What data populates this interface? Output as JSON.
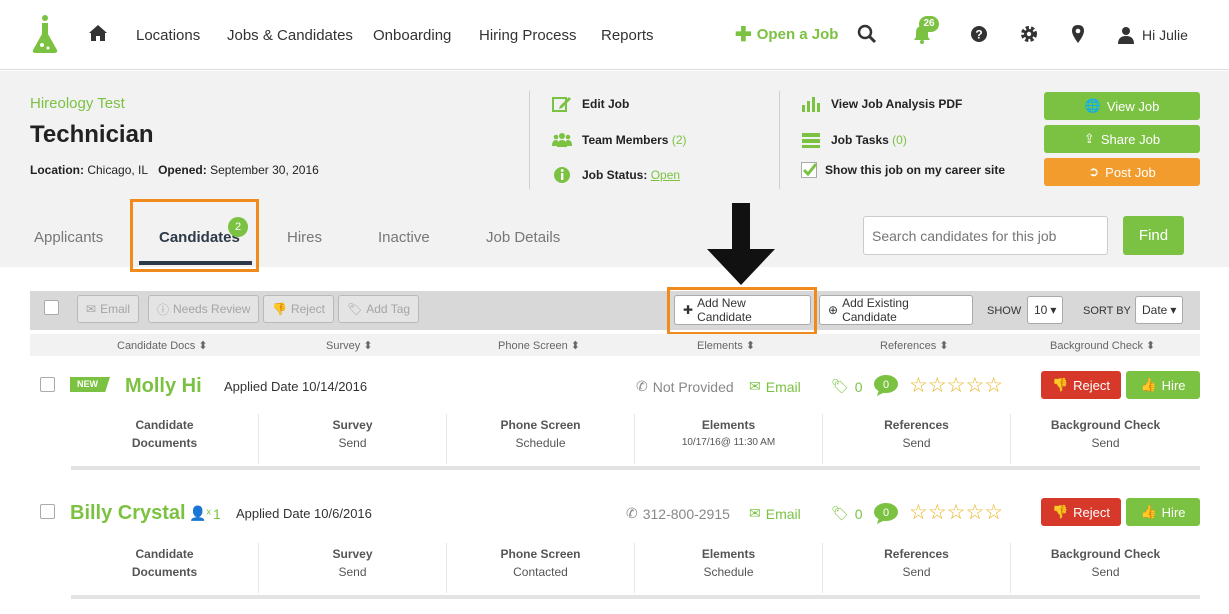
{
  "nav": {
    "links": [
      "Locations",
      "Jobs & Candidates",
      "Onboarding",
      "Hiring Process",
      "Reports"
    ],
    "open_job": "Open a Job",
    "notifications_count": "26",
    "user_greeting": "Hi Julie"
  },
  "job": {
    "company": "Hireology Test",
    "title": "Technician",
    "location_label": "Location:",
    "location": "Chicago, IL",
    "opened_label": "Opened:",
    "opened": "September 30, 2016",
    "edit_job": "Edit Job",
    "team_members": "Team Members",
    "team_members_count": "(2)",
    "job_status_label": "Job Status:",
    "job_status": "Open",
    "view_analysis": "View Job Analysis PDF",
    "job_tasks": "Job Tasks",
    "job_tasks_count": "(0)",
    "show_career_site": "Show this job on my career site",
    "view_job": "View Job",
    "share_job": "Share Job",
    "post_job": "Post Job"
  },
  "tabs": {
    "items": [
      "Applicants",
      "Candidates",
      "Hires",
      "Inactive",
      "Job Details"
    ],
    "candidates_badge": "2",
    "search_placeholder": "Search candidates for this job",
    "find": "Find"
  },
  "toolbar": {
    "email": "Email",
    "needs_review": "Needs Review",
    "reject": "Reject",
    "add_tag": "Add Tag",
    "add_new": "Add New Candidate",
    "add_existing": "Add Existing Candidate",
    "show_label": "SHOW",
    "show_value": "10",
    "sort_label": "SORT BY",
    "sort_value": "Date"
  },
  "columns": [
    "Candidate Docs",
    "Survey",
    "Phone Screen",
    "Elements",
    "References",
    "Background Check"
  ],
  "candidates": [
    {
      "badge": "NEW",
      "name": "Molly Hi",
      "applied": "Applied Date 10/14/2016",
      "phone": "Not Provided",
      "email": "Email",
      "tags": "0",
      "comments": "0",
      "reject": "Reject",
      "hire": "Hire",
      "steps": [
        {
          "title": "Candidate Documents",
          "value": ""
        },
        {
          "title": "Survey",
          "value": "Send"
        },
        {
          "title": "Phone Screen",
          "value": "Schedule"
        },
        {
          "title": "Elements",
          "value": "10/17/16@ 11:30 AM"
        },
        {
          "title": "References",
          "value": "Send"
        },
        {
          "title": "Background Check",
          "value": "Send"
        }
      ]
    },
    {
      "name": "Billy Crystal",
      "referrals": "1",
      "applied": "Applied Date 10/6/2016",
      "phone": "312-800-2915",
      "email": "Email",
      "tags": "0",
      "comments": "0",
      "reject": "Reject",
      "hire": "Hire",
      "steps": [
        {
          "title": "Candidate Documents",
          "value": ""
        },
        {
          "title": "Survey",
          "value": "Send"
        },
        {
          "title": "Phone Screen",
          "value": "Contacted"
        },
        {
          "title": "Elements",
          "value": "Schedule"
        },
        {
          "title": "References",
          "value": "Send"
        },
        {
          "title": "Background Check",
          "value": "Send"
        }
      ]
    }
  ],
  "colors": {
    "brand_green": "#7cc242",
    "orange": "#f39c2e",
    "reject_red": "#d6392a",
    "highlight": "#f08a1c"
  }
}
